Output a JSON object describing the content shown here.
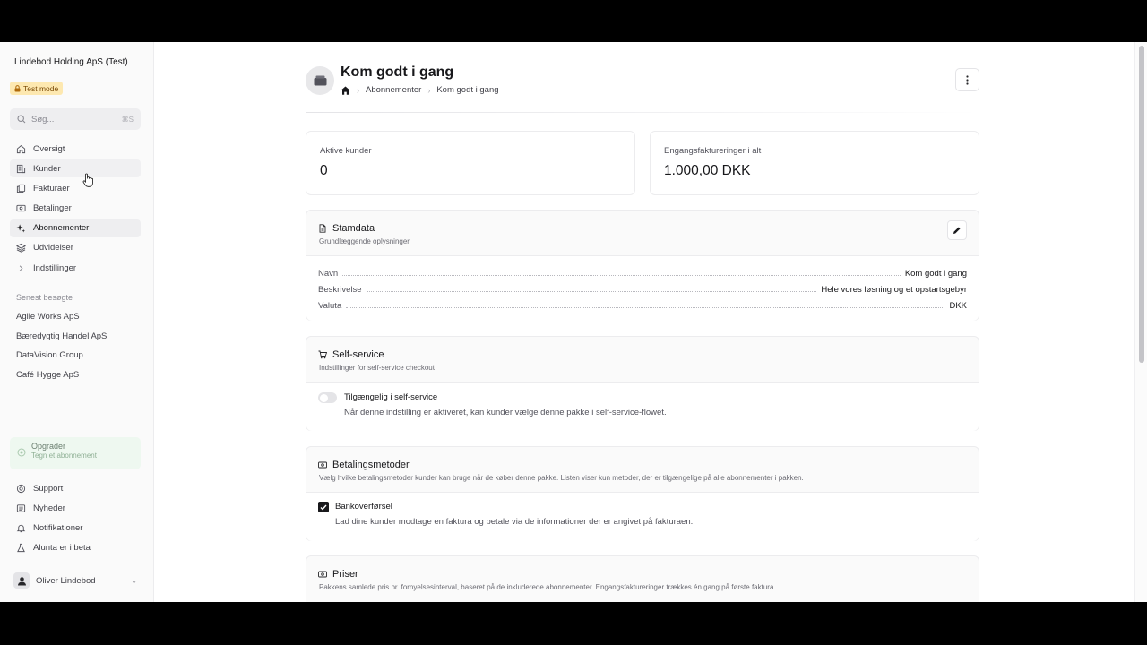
{
  "sidebar": {
    "org_name": "Lindebod Holding ApS (Test)",
    "test_badge": "Test mode",
    "search": {
      "placeholder": "Søg...",
      "shortcut": "⌘S"
    },
    "nav": [
      {
        "label": "Oversigt",
        "icon": "home-icon"
      },
      {
        "label": "Kunder",
        "icon": "building-icon"
      },
      {
        "label": "Fakturaer",
        "icon": "documents-icon"
      },
      {
        "label": "Betalinger",
        "icon": "banknote-icon"
      },
      {
        "label": "Abonnementer",
        "icon": "sparkles-icon"
      },
      {
        "label": "Udvidelser",
        "icon": "layers-icon"
      },
      {
        "label": "Indstillinger",
        "icon": "chevron-right-icon"
      }
    ],
    "recent_label": "Senest besøgte",
    "recent": [
      "Agile Works ApS",
      "Bæredygtig Handel ApS",
      "DataVision Group",
      "Café Hygge ApS"
    ],
    "upgrade": {
      "title": "Opgrader",
      "subtitle": "Tegn et abonnement"
    },
    "bottom_nav": [
      {
        "label": "Support",
        "icon": "lifebuoy-icon"
      },
      {
        "label": "Nyheder",
        "icon": "newspaper-icon"
      },
      {
        "label": "Notifikationer",
        "icon": "bell-icon"
      },
      {
        "label": "Alunta er i beta",
        "icon": "flask-icon"
      }
    ],
    "user_name": "Oliver Lindebod"
  },
  "header": {
    "title": "Kom godt i gang",
    "breadcrumb": [
      "Abonnementer",
      "Kom godt i gang"
    ]
  },
  "stats": [
    {
      "label": "Aktive kunder",
      "value": "0"
    },
    {
      "label": "Engangsfaktureringer i alt",
      "value": "1.000,00 DKK"
    }
  ],
  "stamdata": {
    "title": "Stamdata",
    "subtitle": "Grundlæggende oplysninger",
    "rows": [
      {
        "key": "Navn",
        "value": "Kom godt i gang"
      },
      {
        "key": "Beskrivelse",
        "value": "Hele vores løsning og et opstartsgebyr"
      },
      {
        "key": "Valuta",
        "value": "DKK"
      }
    ]
  },
  "self_service": {
    "title": "Self-service",
    "subtitle": "Indstillinger for self-service checkout",
    "option_title": "Tilgængelig i self-service",
    "option_desc": "Når denne indstilling er aktiveret, kan kunder vælge denne pakke i self-service-flowet.",
    "enabled": false
  },
  "payment_methods": {
    "title": "Betalingsmetoder",
    "subtitle": "Vælg hvilke betalingsmetoder kunder kan bruge når de køber denne pakke. Listen viser kun metoder, der er tilgængelige på alle abonnementer i pakken.",
    "option_title": "Bankoverførsel",
    "option_desc": "Lad dine kunder modtage en faktura og betale via de informationer der er angivet på fakturaen.",
    "checked": true
  },
  "prices": {
    "title": "Priser",
    "subtitle": "Pakkens samlede pris pr. fornyelsesinterval, baseret på de inkluderede abonnementer. Engangsfaktureringer trækkes én gang på første faktura."
  }
}
